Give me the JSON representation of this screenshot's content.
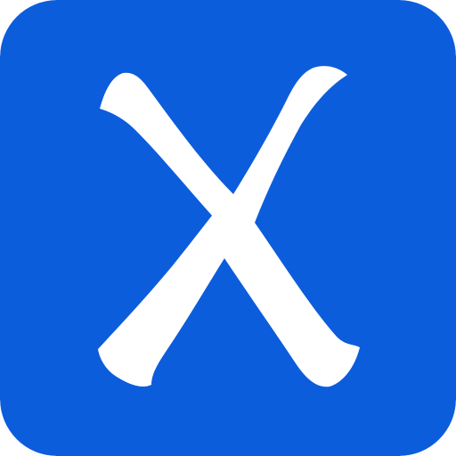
{
  "icon": {
    "name": "x-mark-icon",
    "background_color": "#0c5ddc",
    "glyph_color": "#ffffff"
  }
}
